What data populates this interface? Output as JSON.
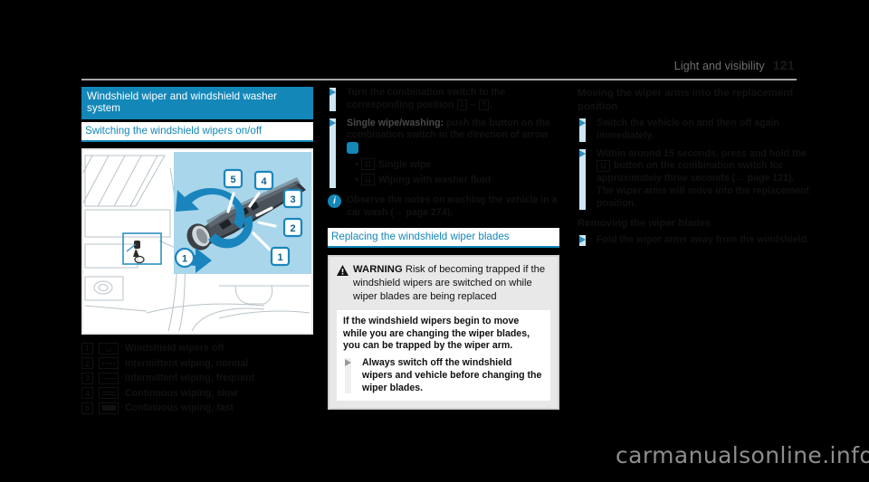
{
  "header": {
    "section_title": "Light and visibility",
    "page_number": "121"
  },
  "left_column": {
    "major_heading": "Windshield wiper and windshield washer system",
    "minor_heading": "Switching the windshield wipers on/off",
    "illustration": {
      "name": "combination-switch-illustration",
      "callouts": [
        "1",
        "2",
        "3",
        "4",
        "5"
      ],
      "inset_callout": "1",
      "background_color": "#a9d6ea"
    },
    "legend": [
      {
        "num": "1",
        "symbol": "wipers-off-icon",
        "label": "Windshield wipers off"
      },
      {
        "num": "2",
        "symbol": "intermittent-normal-icon",
        "label": "Intermittent wiping, normal"
      },
      {
        "num": "3",
        "symbol": "intermittent-frequent-icon",
        "label": "Intermittent wiping, frequent"
      },
      {
        "num": "4",
        "symbol": "continuous-slow-icon",
        "label": "Continuous wiping, slow"
      },
      {
        "num": "5",
        "symbol": "continuous-fast-icon",
        "label": "Continuous wiping, fast"
      }
    ]
  },
  "middle_column": {
    "steps": [
      {
        "text_before": "Turn the combination switch to the corresponding position ",
        "box_a": "1",
        "dash": " – ",
        "box_b": "5",
        "text_after": "."
      }
    ],
    "step2": {
      "lead": "Single wipe/washing:",
      "rest": " push the button on the combination switch in the direction of arrow",
      "marker": "blue-square-marker",
      "period": "."
    },
    "sub_bullets": [
      {
        "symbol": "⊔",
        "label": "Single wipe"
      },
      {
        "symbol": "⊔",
        "label": "Wiping with washer fluid"
      }
    ],
    "info_note": {
      "icon": "info-circle-icon",
      "text": "Observe the notes on washing the vehicle in a car wash (→ page 274)."
    },
    "blades_heading": "Replacing the windshield wiper blades",
    "warning": {
      "icon": "warning-triangle-icon",
      "label": "WARNING",
      "title": "Risk of becoming trapped if the windshield wipers are switched on while wiper blades are being replaced",
      "body": "If the windshield wipers begin to move while you are changing the wiper blades, you can be trapped by the wiper arm.",
      "action": "Always switch off the windshield wipers and vehicle before changing the wiper blades."
    }
  },
  "right_column": {
    "heading_1": "Moving the wiper arms into the replacement position",
    "steps_1": [
      "Switch the vehicle on and then off again immediately.",
      "Within around 15 seconds, press and hold the"
    ],
    "step2_boxed_symbol": "⊔",
    "step2_rest": "button on the combination switch for approximately three seconds (→ page 121). The wiper arms will move into the replacement position.",
    "heading_2": "Removing the wiper blades",
    "steps_2": [
      "Fold the wiper arms away from the windshield."
    ]
  },
  "watermark": "carmanualsonline.info",
  "colors": {
    "brand_blue": "#1387b8",
    "illustration_blue": "#a9d6ea",
    "rail_blue": "#cfe7f3",
    "warning_gray": "#e8e8e8"
  }
}
